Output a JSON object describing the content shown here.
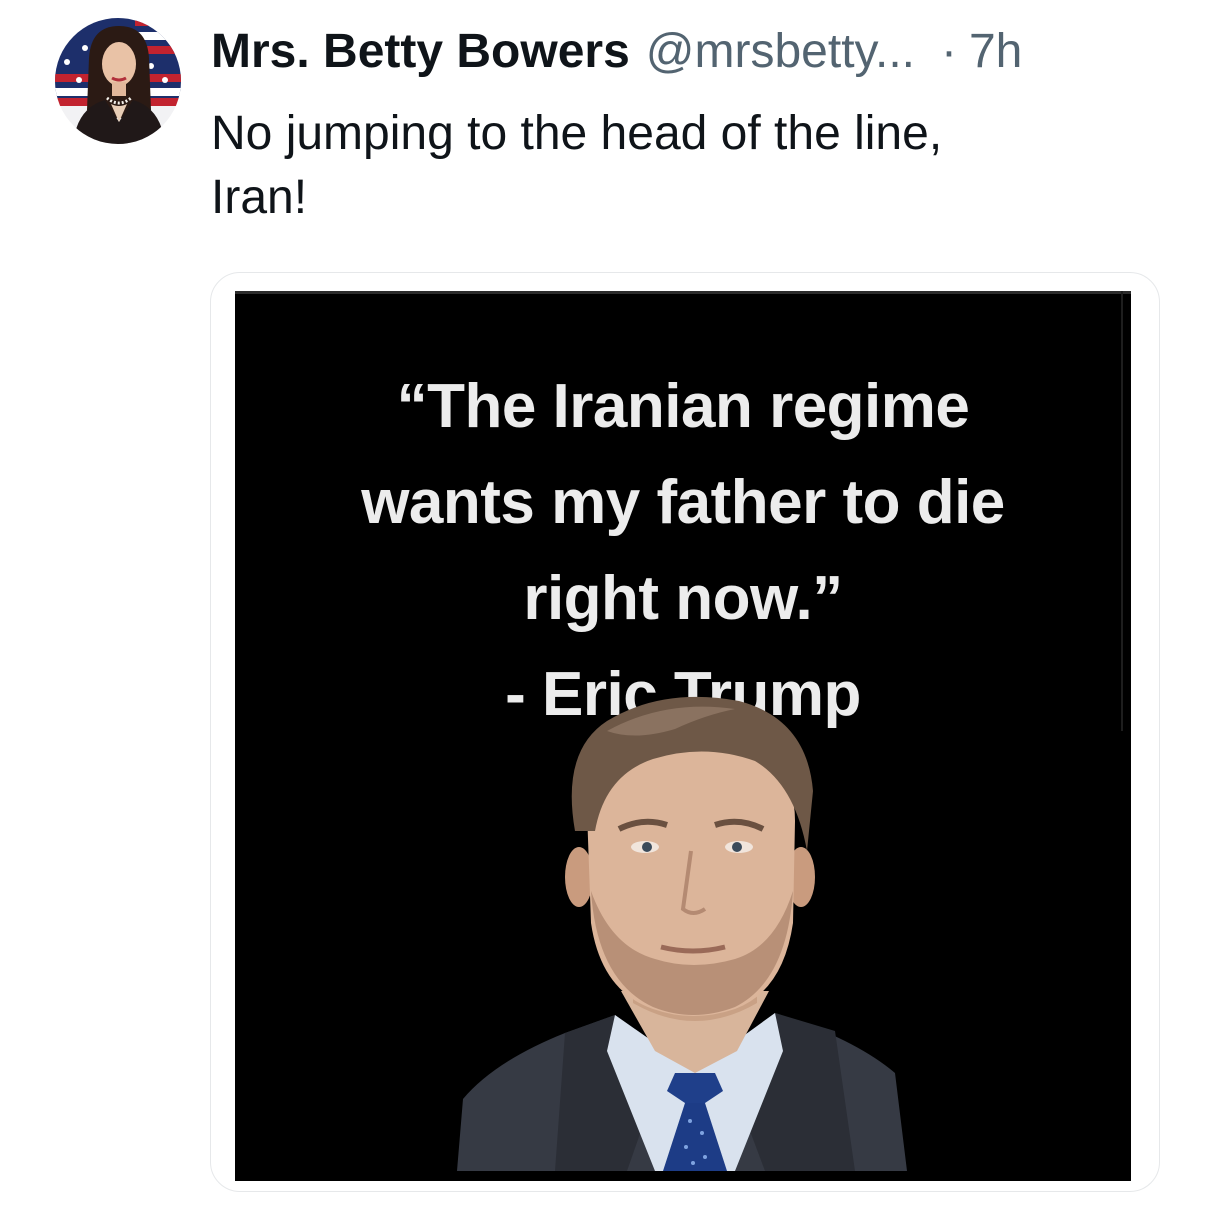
{
  "tweet": {
    "author": {
      "display_name": "Mrs. Betty Bowers",
      "handle": "@mrsbetty...",
      "separator": "·",
      "timestamp": "7h"
    },
    "text_lines": [
      "No jumping to the head of the line,",
      "Iran!"
    ],
    "media": {
      "quote_lines": [
        "“The Iranian regime",
        "wants my father to die",
        "right now.”",
        "- Eric Trump"
      ],
      "background_color": "#000000",
      "text_color": "#ececec"
    }
  },
  "colors": {
    "primary_text": "#0f1419",
    "secondary_text": "#536471",
    "card_border": "#e6e8ea"
  }
}
